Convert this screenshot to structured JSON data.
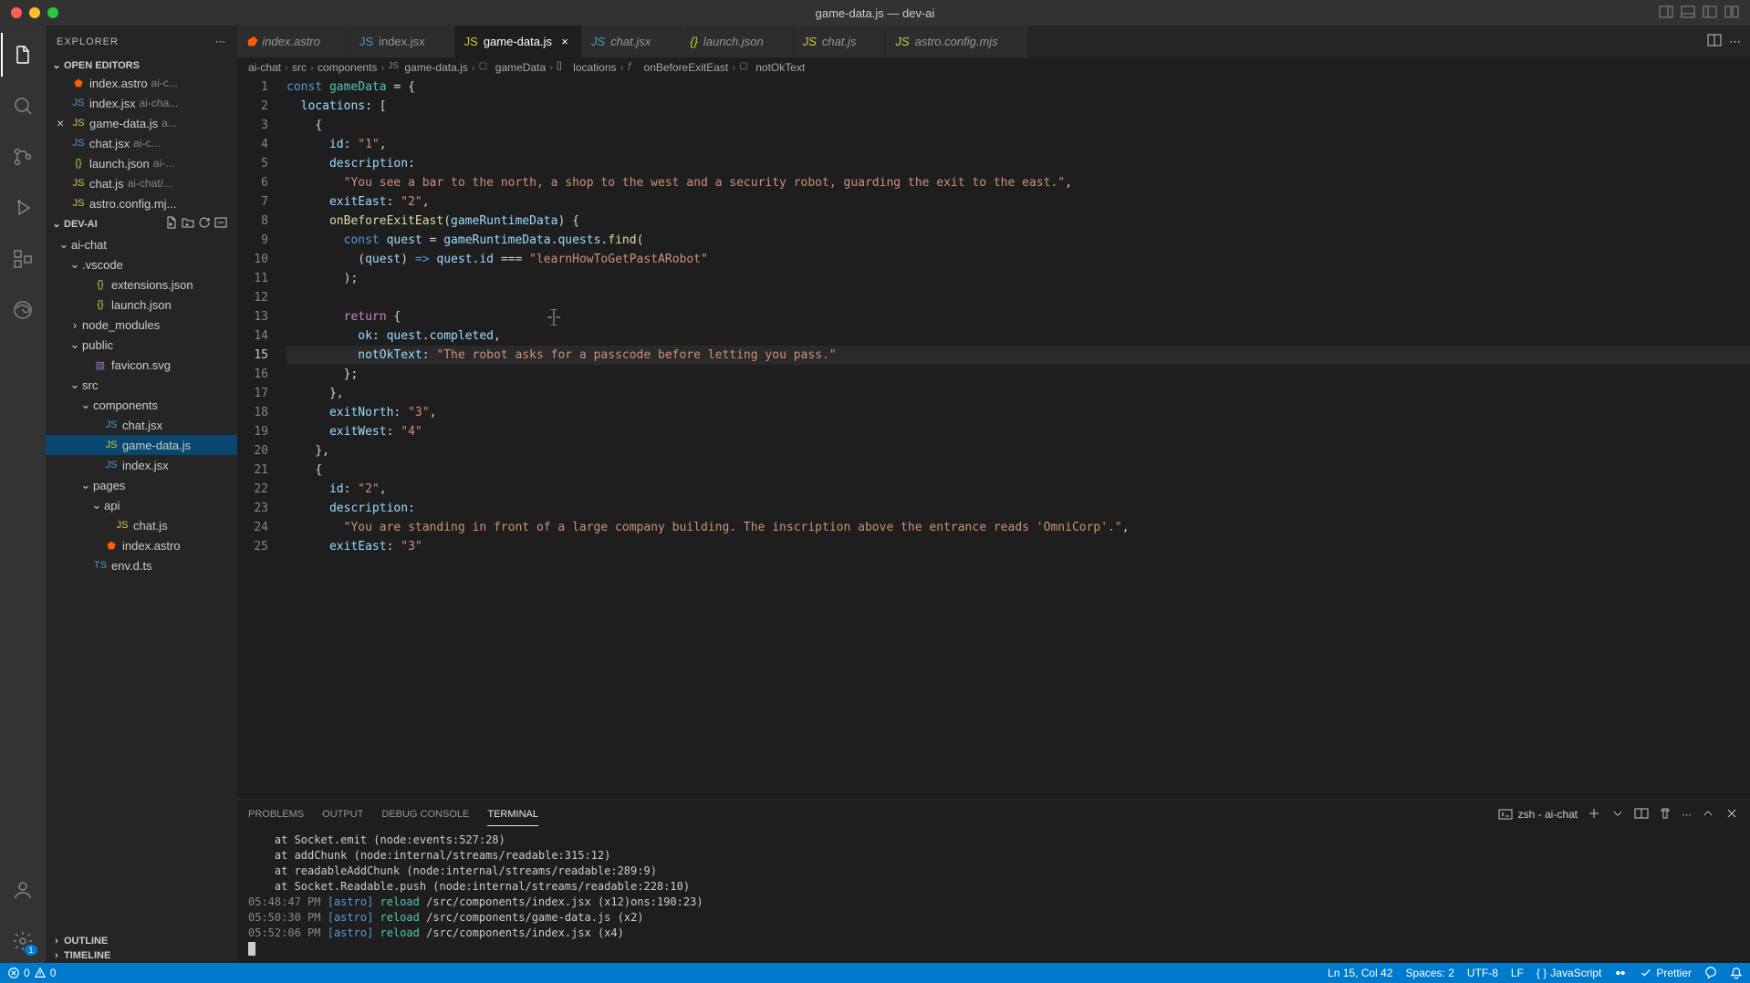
{
  "window": {
    "title": "game-data.js — dev-ai"
  },
  "explorer": {
    "title": "EXPLORER",
    "openEditors": {
      "label": "OPEN EDITORS",
      "items": [
        {
          "name": "index.astro",
          "desc": "ai-c...",
          "icon": "astro"
        },
        {
          "name": "index.jsx",
          "desc": "ai-cha...",
          "icon": "jsx"
        },
        {
          "name": "game-data.js",
          "desc": "a...",
          "icon": "js",
          "active": true
        },
        {
          "name": "chat.jsx",
          "desc": "ai-c...",
          "icon": "jsx"
        },
        {
          "name": "launch.json",
          "desc": "ai-...",
          "icon": "json"
        },
        {
          "name": "chat.js",
          "desc": "ai-chat/...",
          "icon": "js"
        },
        {
          "name": "astro.config.mj...",
          "desc": "",
          "icon": "js"
        }
      ]
    },
    "folder": {
      "label": "DEV-AI",
      "tree": [
        {
          "name": "ai-chat",
          "type": "folder",
          "indent": 0,
          "expanded": true
        },
        {
          "name": ".vscode",
          "type": "folder",
          "indent": 1,
          "expanded": true
        },
        {
          "name": "extensions.json",
          "type": "file",
          "icon": "json",
          "indent": 2
        },
        {
          "name": "launch.json",
          "type": "file",
          "icon": "json",
          "indent": 2
        },
        {
          "name": "node_modules",
          "type": "folder",
          "indent": 1,
          "expanded": false
        },
        {
          "name": "public",
          "type": "folder",
          "indent": 1,
          "expanded": true
        },
        {
          "name": "favicon.svg",
          "type": "file",
          "icon": "svg",
          "indent": 2
        },
        {
          "name": "src",
          "type": "folder",
          "indent": 1,
          "expanded": true
        },
        {
          "name": "components",
          "type": "folder",
          "indent": 2,
          "expanded": true
        },
        {
          "name": "chat.jsx",
          "type": "file",
          "icon": "jsx",
          "indent": 3
        },
        {
          "name": "game-data.js",
          "type": "file",
          "icon": "js",
          "indent": 3,
          "active": true
        },
        {
          "name": "index.jsx",
          "type": "file",
          "icon": "jsx",
          "indent": 3
        },
        {
          "name": "pages",
          "type": "folder",
          "indent": 2,
          "expanded": true
        },
        {
          "name": "api",
          "type": "folder",
          "indent": 3,
          "expanded": true
        },
        {
          "name": "chat.js",
          "type": "file",
          "icon": "js",
          "indent": 4
        },
        {
          "name": "index.astro",
          "type": "file",
          "icon": "astro",
          "indent": 3
        },
        {
          "name": "env.d.ts",
          "type": "file",
          "icon": "ts",
          "indent": 2
        }
      ]
    },
    "outline": "OUTLINE",
    "timeline": "TIMELINE"
  },
  "tabs": [
    {
      "name": "index.astro",
      "icon": "astro",
      "italic": true
    },
    {
      "name": "index.jsx",
      "icon": "jsx"
    },
    {
      "name": "game-data.js",
      "icon": "js",
      "active": true
    },
    {
      "name": "chat.jsx",
      "icon": "jsx",
      "italic": true
    },
    {
      "name": "launch.json",
      "icon": "json",
      "italic": true
    },
    {
      "name": "chat.js",
      "icon": "js",
      "italic": true
    },
    {
      "name": "astro.config.mjs",
      "icon": "js",
      "italic": true
    }
  ],
  "breadcrumbs": [
    "ai-chat",
    "src",
    "components",
    "game-data.js",
    "gameData",
    "locations",
    "onBeforeExitEast",
    "notOkText"
  ],
  "code": {
    "lines": [
      {
        "n": 1,
        "html": "<span class='kw'>const</span> <span class='cls'>gameData</span> <span class='op'>=</span> <span class='pn'>{</span>"
      },
      {
        "n": 2,
        "html": "  <span class='prop'>locations</span><span class='pn'>:</span> <span class='pn'>[</span>"
      },
      {
        "n": 3,
        "html": "    <span class='pn'>{</span>"
      },
      {
        "n": 4,
        "html": "      <span class='prop'>id</span><span class='pn'>:</span> <span class='str'>\"1\"</span><span class='pn'>,</span>"
      },
      {
        "n": 5,
        "html": "      <span class='prop'>description</span><span class='pn'>:</span>"
      },
      {
        "n": 6,
        "html": "        <span class='str'>\"You see a bar to the north, a shop to the west and a security robot, guarding the exit to the east.\"</span><span class='pn'>,</span>"
      },
      {
        "n": 7,
        "html": "      <span class='prop'>exitEast</span><span class='pn'>:</span> <span class='str'>\"2\"</span><span class='pn'>,</span>"
      },
      {
        "n": 8,
        "html": "      <span class='fn'>onBeforeExitEast</span><span class='pn'>(</span><span class='param'>gameRuntimeData</span><span class='pn'>)</span> <span class='pn'>{</span>"
      },
      {
        "n": 9,
        "html": "        <span class='kw'>const</span> <span class='var'>quest</span> <span class='op'>=</span> <span class='var'>gameRuntimeData</span><span class='pn'>.</span><span class='var'>quests</span><span class='pn'>.</span><span class='fn'>find</span><span class='pn'>(</span>"
      },
      {
        "n": 10,
        "html": "          <span class='pn'>(</span><span class='param'>quest</span><span class='pn'>)</span> <span class='kw'>=&gt;</span> <span class='var'>quest</span><span class='pn'>.</span><span class='var'>id</span> <span class='op'>===</span> <span class='str'>\"learnHowToGetPastARobot\"</span>"
      },
      {
        "n": 11,
        "html": "        <span class='pn'>);</span>"
      },
      {
        "n": 12,
        "html": ""
      },
      {
        "n": 13,
        "html": "        <span class='kw2'>return</span> <span class='pn'>{</span>"
      },
      {
        "n": 14,
        "html": "          <span class='prop'>ok</span><span class='pn'>:</span> <span class='var'>quest</span><span class='pn'>.</span><span class='var'>completed</span><span class='pn'>,</span>"
      },
      {
        "n": 15,
        "html": "          <span class='prop'>notOkText</span><span class='pn'>:</span> <span class='str'>\"The robot asks for a passcode before letting you pass.\"</span>",
        "current": true
      },
      {
        "n": 16,
        "html": "        <span class='pn'>};</span>"
      },
      {
        "n": 17,
        "html": "      <span class='pn'>},</span>"
      },
      {
        "n": 18,
        "html": "      <span class='prop'>exitNorth</span><span class='pn'>:</span> <span class='str'>\"3\"</span><span class='pn'>,</span>"
      },
      {
        "n": 19,
        "html": "      <span class='prop'>exitWest</span><span class='pn'>:</span> <span class='str'>\"4\"</span>"
      },
      {
        "n": 20,
        "html": "    <span class='pn'>},</span>"
      },
      {
        "n": 21,
        "html": "    <span class='pn'>{</span>"
      },
      {
        "n": 22,
        "html": "      <span class='prop'>id</span><span class='pn'>:</span> <span class='str'>\"2\"</span><span class='pn'>,</span>"
      },
      {
        "n": 23,
        "html": "      <span class='prop'>description</span><span class='pn'>:</span>"
      },
      {
        "n": 24,
        "html": "        <span class='str'>\"You are standing in front of a large company building. The inscription above the entrance reads 'OmniCorp'.\"</span><span class='pn'>,</span>"
      },
      {
        "n": 25,
        "html": "      <span class='prop'>exitEast</span><span class='pn'>:</span> <span class='str'>\"3\"</span>"
      }
    ]
  },
  "panel": {
    "tabs": {
      "problems": "PROBLEMS",
      "output": "OUTPUT",
      "debug": "DEBUG CONSOLE",
      "terminal": "TERMINAL"
    },
    "termLabel": "zsh - ai-chat",
    "lines": [
      {
        "html": "    at Socket.emit (node:events:527:28)"
      },
      {
        "html": "    at addChunk (node:internal/streams/readable:315:12)"
      },
      {
        "html": "    at readableAddChunk (node:internal/streams/readable:289:9)"
      },
      {
        "html": "    at Socket.Readable.push (node:internal/streams/readable:228:10)"
      },
      {
        "html": "<span class='t-stamp'>05:48:47 PM</span> <span class='t-tag'>[astro]</span> <span class='t-info'>reload</span> /src/components/index.jsx (x12)ons:190:23)"
      },
      {
        "html": "<span class='t-stamp'>05:50:30 PM</span> <span class='t-tag'>[astro]</span> <span class='t-info'>reload</span> /src/components/game-data.js (x2)"
      },
      {
        "html": "<span class='t-stamp'>05:52:06 PM</span> <span class='t-tag'>[astro]</span> <span class='t-info'>reload</span> /src/components/index.jsx (x4)"
      }
    ]
  },
  "statusbar": {
    "errors": "0",
    "warnings": "0",
    "cursor": "Ln 15, Col 42",
    "spaces": "Spaces: 2",
    "encoding": "UTF-8",
    "eol": "LF",
    "lang": "JavaScript",
    "prettier": "Prettier"
  }
}
